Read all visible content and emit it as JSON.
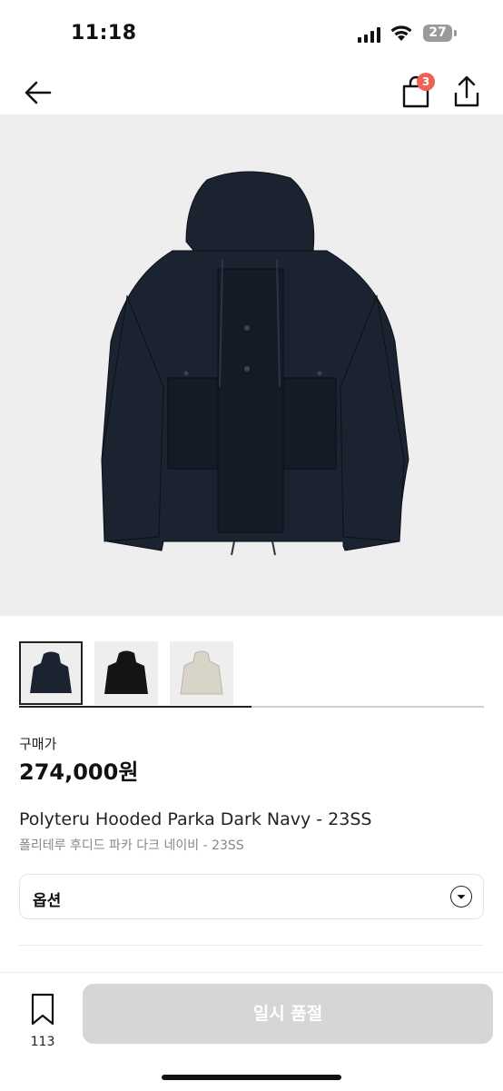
{
  "status_bar": {
    "time": "11:18",
    "battery": "27"
  },
  "header": {
    "cart_count": "3"
  },
  "gallery": {
    "progress": 0.5,
    "thumbnails": [
      {
        "name": "thumb-dark-navy",
        "color": "#1c2330",
        "selected": true
      },
      {
        "name": "thumb-black",
        "color": "#141414",
        "selected": false
      },
      {
        "name": "thumb-ivory",
        "color": "#d9d4c8",
        "selected": false
      }
    ]
  },
  "product": {
    "price_label": "구매가",
    "price": "274,000원",
    "name_en": "Polyteru Hooded Parka Dark Navy - 23SS",
    "name_ko": "폴리테루 후디드 파카 다크 네이비 - 23SS"
  },
  "options": {
    "label": "옵션"
  },
  "bottom_bar": {
    "bookmark_count": "113",
    "action_label": "일시 품절"
  },
  "colors": {
    "accent_badge": "#ef6253",
    "disabled_button": "#d6d6d6",
    "image_bg": "#eeeeee"
  }
}
